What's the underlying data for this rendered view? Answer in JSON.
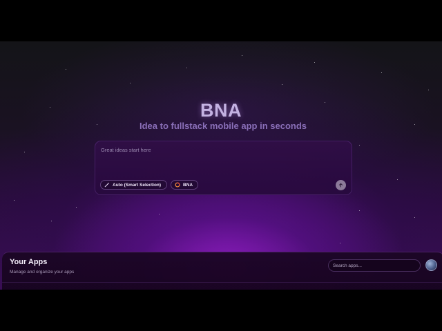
{
  "hero": {
    "title": "BNA",
    "subtitle": "Idea to fullstack mobile app in seconds"
  },
  "prompt": {
    "placeholder": "Great ideas start here",
    "model_chip_label": "Auto (Smart Selection)",
    "model_chip_icon": "magic-wand-icon",
    "bna_chip_label": "BNA",
    "bna_chip_icon": "bna-logo-icon",
    "send_icon": "arrow-up-icon"
  },
  "apps": {
    "title": "Your Apps",
    "subtitle": "Manage and organize your apps",
    "search_placeholder": "Search apps..."
  },
  "colors": {
    "accent": "#8a2be2",
    "background_glow": "#9b1fd0",
    "title": "#c4b2e2"
  }
}
